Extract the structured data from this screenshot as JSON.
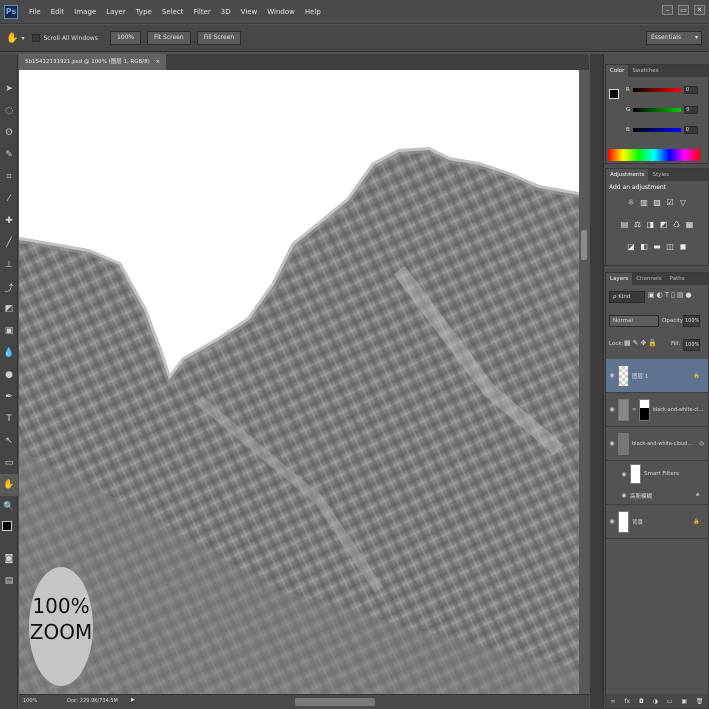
{
  "menubar": {
    "logo": "Ps",
    "items": [
      "File",
      "Edit",
      "Image",
      "Layer",
      "Type",
      "Select",
      "Filter",
      "3D",
      "View",
      "Window",
      "Help"
    ]
  },
  "options": {
    "scroll_all_label": "Scroll All Windows",
    "btn_100": "100%",
    "btn_fit": "Fit Screen",
    "btn_fill": "Fill Screen",
    "workspace": "Essentials"
  },
  "document": {
    "tab_title": "5b15412131921.psd @ 100% (图层 1, RGB/8)",
    "tab_close": "×",
    "status_zoom": "100%",
    "status_doc": "Doc: 229.9K/734.5M"
  },
  "overlay": {
    "zoom_line1": "100%",
    "zoom_line2": "ZOOM"
  },
  "color_panel": {
    "tabs": [
      "Color",
      "Swatches"
    ],
    "channels": [
      {
        "label": "R",
        "value": "0",
        "color": "#d02020"
      },
      {
        "label": "G",
        "value": "0",
        "color": "#20b030"
      },
      {
        "label": "B",
        "value": "0",
        "color": "#2040d0"
      }
    ]
  },
  "adjustments_panel": {
    "tabs": [
      "Adjustments",
      "Styles"
    ],
    "heading": "Add an adjustment",
    "icons_row1": [
      "☼",
      "▥",
      "▨",
      "☑",
      "▽"
    ],
    "icons_row2": [
      "▤",
      "⚖",
      "◨",
      "◩",
      "♺",
      "▦"
    ],
    "icons_row3": [
      "◪",
      "◧",
      "▬",
      "◫",
      "◼"
    ]
  },
  "layers_panel": {
    "tabs": [
      "Layers",
      "Channels",
      "Paths"
    ],
    "filter_kind": "ρ Kind",
    "blend_mode": "Normal",
    "opacity_label": "Opacity:",
    "opacity_value": "100%",
    "lock_label": "Lock:",
    "fill_label": "Fill:",
    "fill_value": "100%",
    "layers": [
      {
        "name": "图层 1",
        "selected": true
      },
      {
        "name": "black-and-white-cl...",
        "selected": false
      },
      {
        "name": "black-and-white-cloud...",
        "selected": false
      },
      {
        "name": "Smart Filters",
        "selected": false
      },
      {
        "name": "高斯模糊",
        "selected": false
      },
      {
        "name": "背景",
        "selected": false
      }
    ],
    "footer_icons": [
      "∞",
      "fx",
      "◘",
      "◑",
      "▭",
      "▣",
      "🗑"
    ]
  },
  "colors": {
    "accent": "#5b8ad1",
    "selected_layer": "#5d7390"
  }
}
